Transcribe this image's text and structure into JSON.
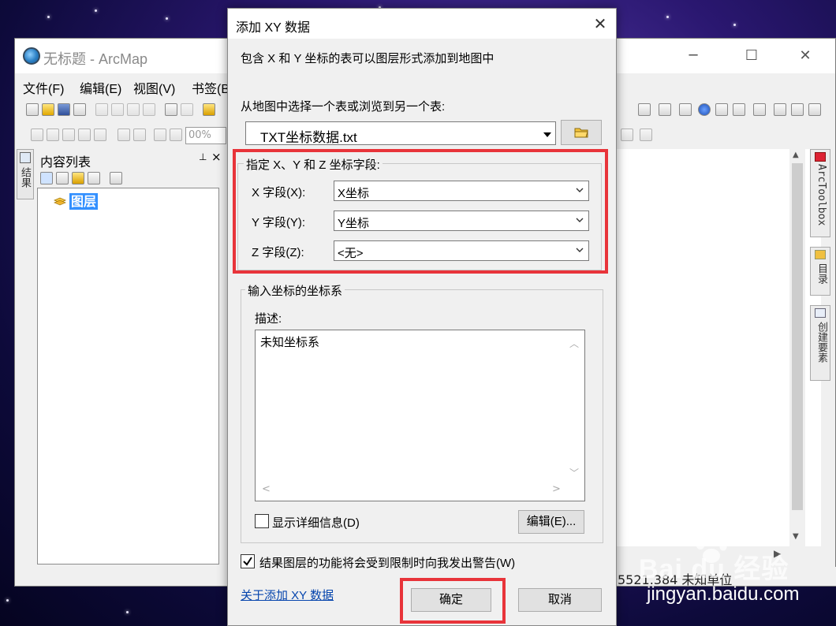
{
  "arcmap": {
    "title": "无标题 - ArcMap",
    "menu": [
      "文件(F)",
      "编辑(E)",
      "视图(V)",
      "书签(B"
    ],
    "zoom_value": "00%",
    "toc": {
      "side_tab": "结果",
      "title": "内容列表",
      "pin": "ᵖ",
      "close": "×",
      "layer": "图层"
    },
    "right_tabs": [
      "ArcToolbox",
      "目录",
      "创建要素"
    ],
    "status_text": "5521.384  未知单位"
  },
  "dialog": {
    "title": "添加 XY 数据",
    "close": "✕",
    "intro": "包含 X 和 Y 坐标的表可以图层形式添加到地图中",
    "choose_label": "从地图中选择一个表或浏览到另一个表:",
    "table_value": "TXT坐标数据.txt",
    "fields_group": "指定 X、Y 和 Z 坐标字段:",
    "x_label": "X 字段(X):",
    "x_value": "X坐标",
    "y_label": "Y 字段(Y):",
    "y_value": "Y坐标",
    "z_label": "Z 字段(Z):",
    "z_value": "<无>",
    "crs_group": "输入坐标的坐标系",
    "desc_label": "描述:",
    "desc_value": "未知坐标系",
    "show_details": "显示详细信息(D)",
    "edit_button": "编辑(E)...",
    "warn_label": "结果图层的功能将会受到限制时向我发出警告(W)",
    "warn_checked": true,
    "about_link": "关于添加 XY 数据",
    "ok_button": "确定",
    "cancel_button": "取消"
  },
  "highlight_color": "#e8343a",
  "watermark": {
    "brand": "Bai du 经验",
    "url": "jingyan.baidu.com"
  }
}
